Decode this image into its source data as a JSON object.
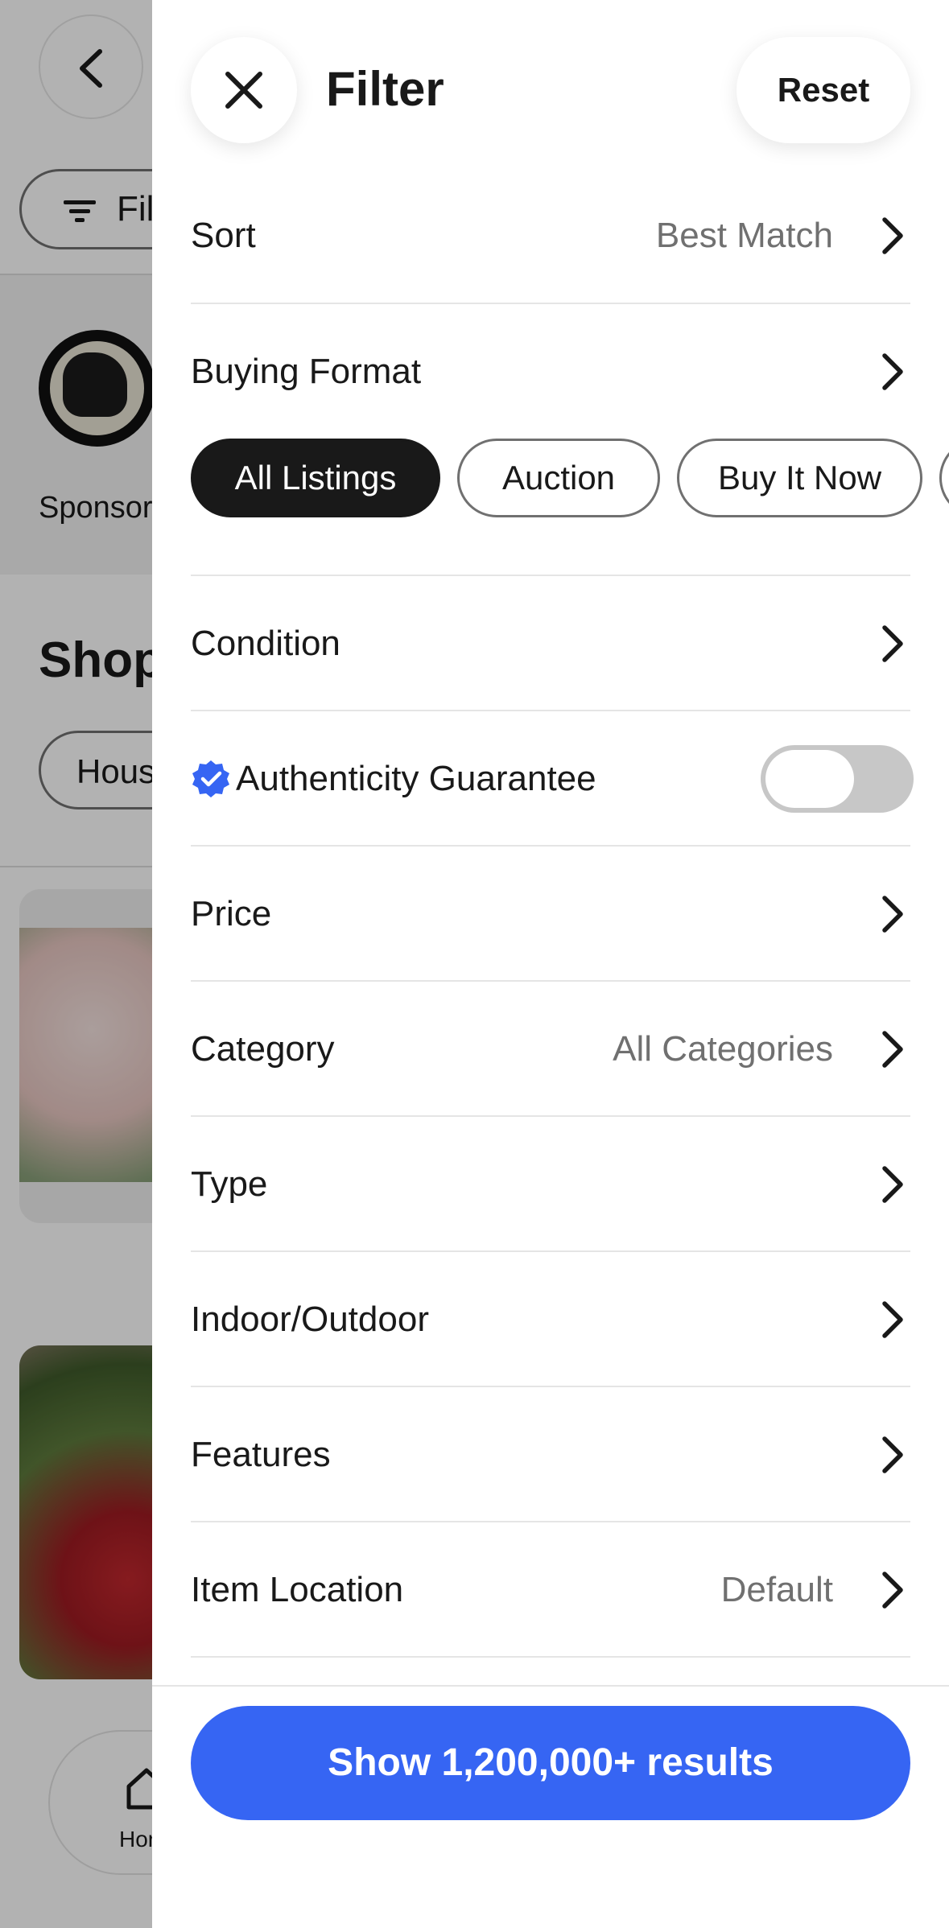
{
  "background": {
    "filter_chip_label": "Fil",
    "sponsor_text": "Sponsor",
    "shop_title": "Shop",
    "house_chip_label": "Hous",
    "home_label": "Hor"
  },
  "panel": {
    "title": "Filter",
    "reset_label": "Reset",
    "rows": {
      "sort": {
        "label": "Sort",
        "value": "Best Match"
      },
      "buying_format": {
        "label": "Buying Format"
      },
      "condition": {
        "label": "Condition"
      },
      "authenticity": {
        "label": "Authenticity Guarantee",
        "enabled": false
      },
      "price": {
        "label": "Price"
      },
      "category": {
        "label": "Category",
        "value": "All Categories"
      },
      "type": {
        "label": "Type"
      },
      "indoor_outdoor": {
        "label": "Indoor/Outdoor"
      },
      "features": {
        "label": "Features"
      },
      "item_location": {
        "label": "Item Location",
        "value": "Default"
      }
    },
    "buying_format_chips": [
      {
        "label": "All Listings",
        "selected": true
      },
      {
        "label": "Auction",
        "selected": false
      },
      {
        "label": "Buy It Now",
        "selected": false
      }
    ],
    "show_results_label": "Show 1,200,000+ results"
  },
  "colors": {
    "accent_blue": "#3665f3",
    "selected_chip": "#191919",
    "toggle_off": "#c7c7c7"
  },
  "icons": [
    "back-arrow-icon",
    "filter-lines-icon",
    "home-icon",
    "close-icon",
    "chevron-right-icon",
    "verified-check-icon"
  ]
}
